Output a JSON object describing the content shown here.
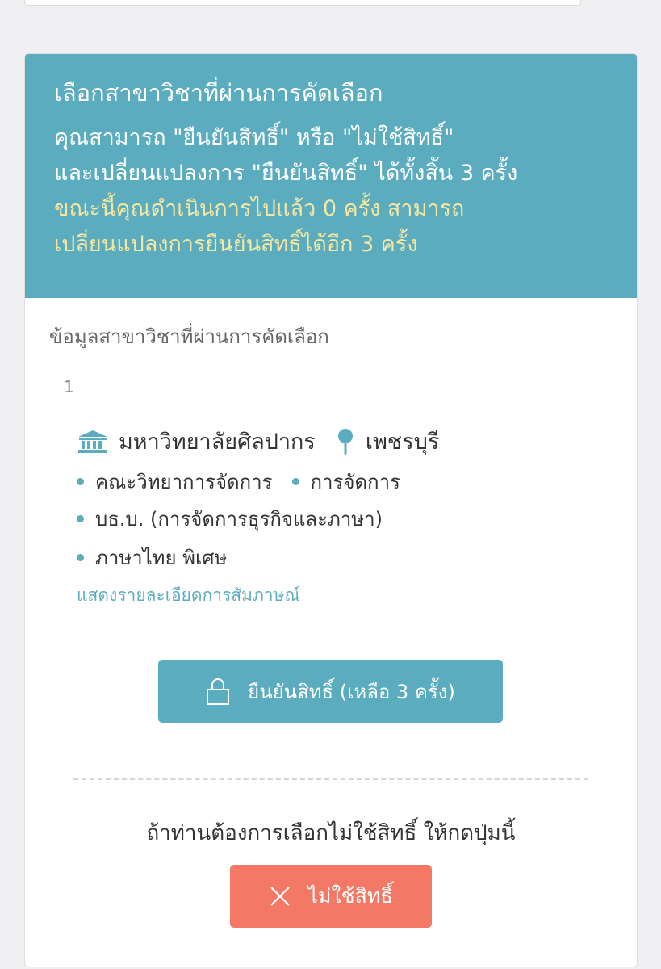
{
  "header": {
    "title": "เลือกสาขาวิชาที่ผ่านการคัดเลือก",
    "line1": "คุณสามารถ \"ยืนยันสิทธิ์\" หรือ \"ไม่ใช้สิทธิ์\"",
    "line2": "และเปลี่ยนแปลงการ \"ยืนยันสิทธิ์\" ได้ทั้งสิ้น 3 ครั้ง",
    "status_line1": "ขณะนี้คุณดำเนินการไปแล้ว 0 ครั้ง สามารถ",
    "status_line2": "เปลี่ยนแปลงการยืนยันสิทธิ์ได้อีก 3 ครั้ง",
    "background_color": "#5aacbe",
    "highlight_color": "#f6e7a0"
  },
  "section": {
    "label": "ข้อมูลสาขาวิชาที่ผ่านการคัดเลือก"
  },
  "item": {
    "index": "1",
    "university_icon": "university-building-icon",
    "university": "มหาวิทยาลัยศิลปากร",
    "province_icon": "map-pin-icon",
    "province": "เพชรบุรี",
    "faculty": "คณะวิทยาการจัดการ",
    "field": "การจัดการ",
    "program": "บธ.บ. (การจัดการธุรกิจและภาษา)",
    "track": "ภาษาไทย พิเศษ",
    "detail_link": "แสดงรายละเอียดการสัมภาษณ์"
  },
  "confirm": {
    "icon": "lock-icon",
    "label": "ยืนยันสิทธิ์ (เหลือ 3 ครั้ง)",
    "color": "#5aacbe"
  },
  "decline": {
    "prompt": "ถ้าท่านต้องการเลือกไม่ใช้สิทธิ์ ให้กดปุ่มนี้",
    "icon": "close-icon",
    "label": "ไม่ใช้สิทธิ์",
    "color": "#f47866"
  }
}
